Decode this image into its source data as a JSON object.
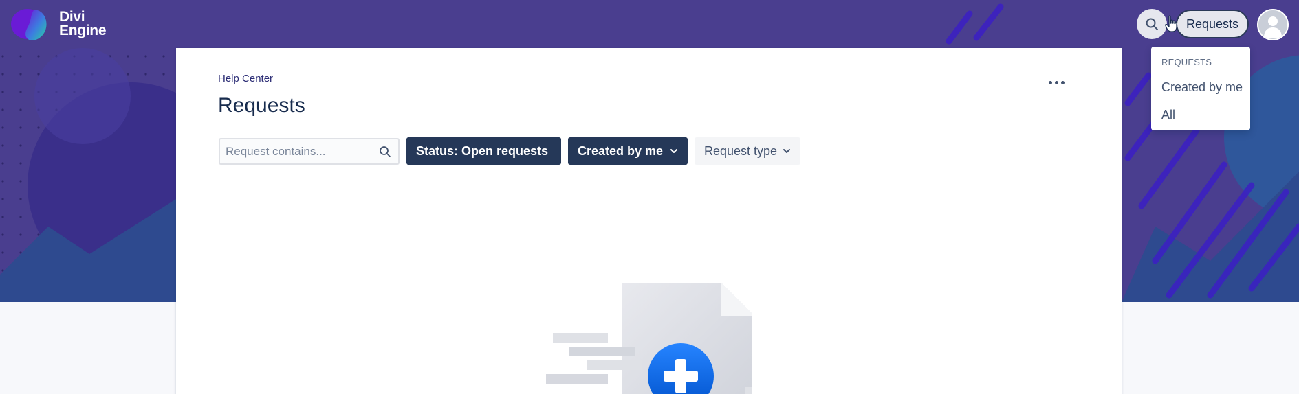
{
  "brand": {
    "line1": "Divi",
    "line2": "Engine"
  },
  "header": {
    "requests_label": "Requests"
  },
  "dropdown": {
    "heading": "REQUESTS",
    "items": [
      {
        "label": "Created by me"
      },
      {
        "label": "All"
      }
    ]
  },
  "main": {
    "breadcrumb": "Help Center",
    "title": "Requests",
    "search": {
      "placeholder": "Request contains...",
      "value": ""
    },
    "filters": [
      {
        "label": "Status: Open requests"
      },
      {
        "label": "Created by me"
      },
      {
        "label": "Request type"
      }
    ]
  },
  "icons": {
    "search": "search-icon",
    "chevron": "chevron-down-icon",
    "more": "more-horizontal-icon",
    "avatar": "user-avatar-icon",
    "cursor": "hand-pointer-icon"
  },
  "colors": {
    "hero_bg": "#4a3e8f",
    "filter_dark": "#253858",
    "accent_blue": "#0065ff"
  }
}
